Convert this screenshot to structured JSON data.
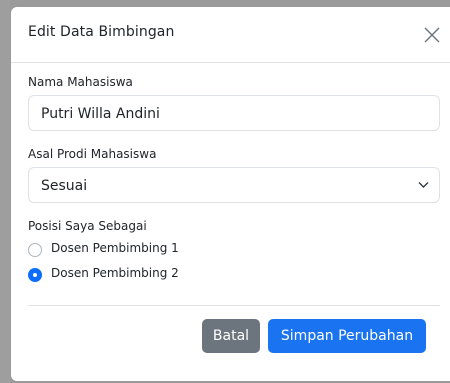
{
  "modal": {
    "title": "Edit Data Bimbingan",
    "close_icon": "close-icon"
  },
  "form": {
    "name_label": "Nama Mahasiswa",
    "name_value": "Putri Willa Andini",
    "prodi_label": "Asal Prodi Mahasiswa",
    "prodi_value": "Sesuai",
    "position_label": "Posisi Saya Sebagai",
    "options": [
      {
        "label": "Dosen Pembimbing 1",
        "checked": false
      },
      {
        "label": "Dosen Pembimbing 2",
        "checked": true
      }
    ]
  },
  "footer": {
    "cancel_label": "Batal",
    "save_label": "Simpan Perubahan"
  },
  "colors": {
    "primary": "#1a73f0",
    "secondary": "#6c757d",
    "border": "#dee2e6",
    "backdrop": "#9a9a9a"
  }
}
